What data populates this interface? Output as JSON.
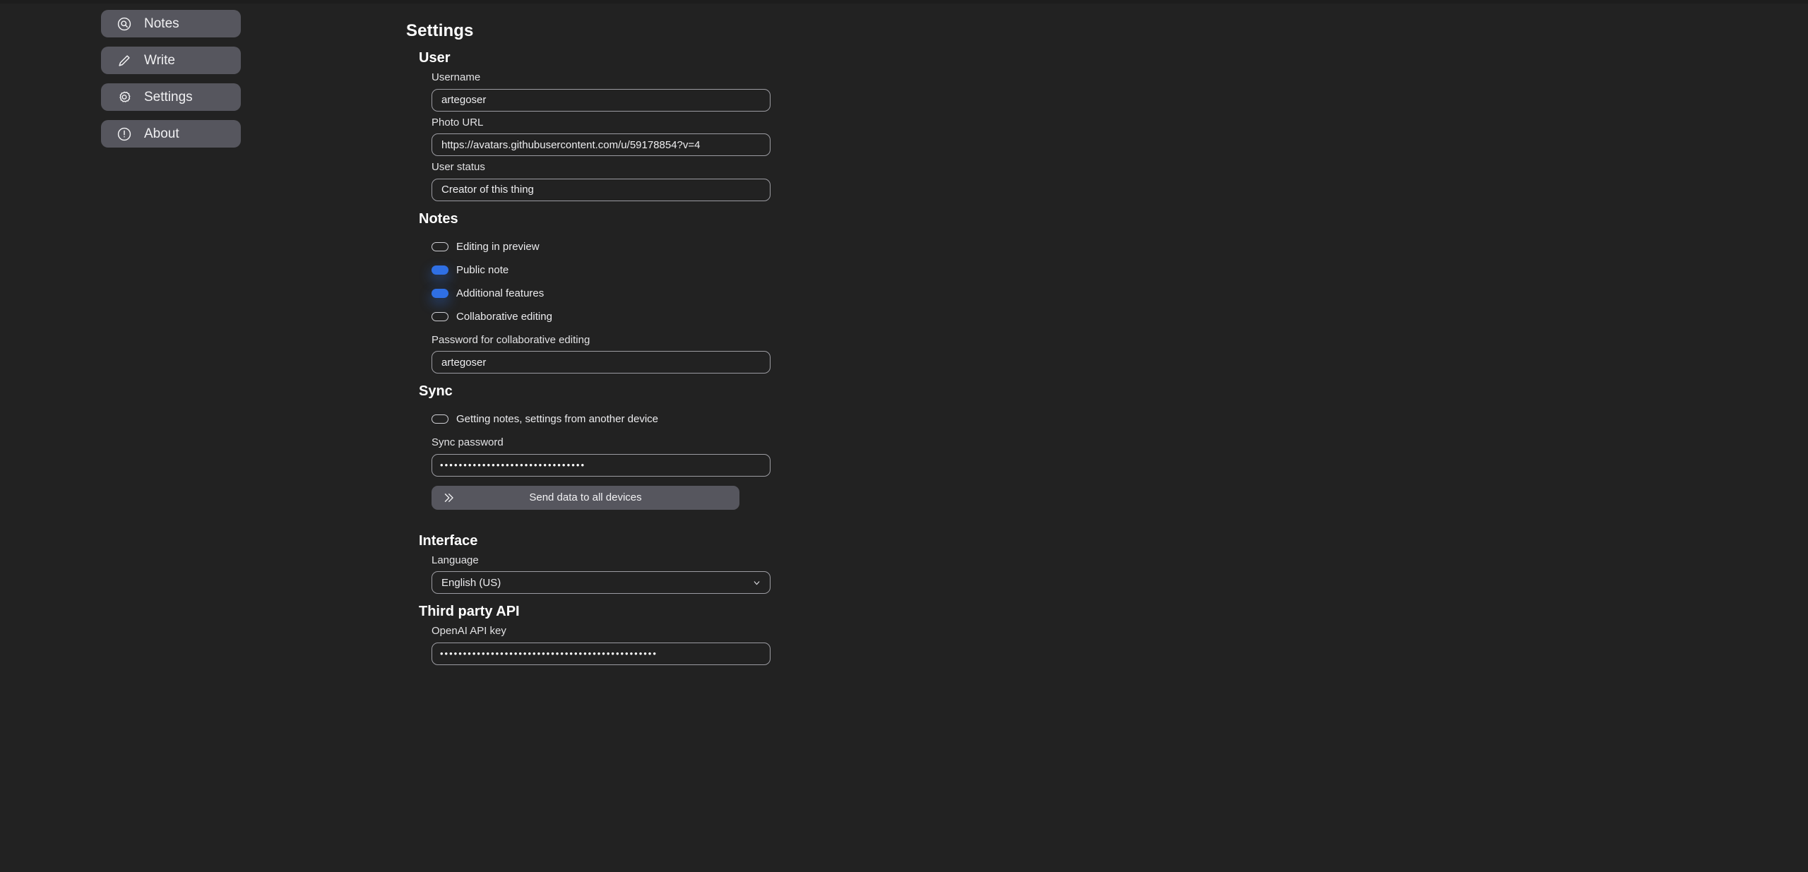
{
  "sidebar": {
    "items": [
      {
        "label": "Notes",
        "icon": "search-circle-icon",
        "name": "notes"
      },
      {
        "label": "Write",
        "icon": "pencil-icon",
        "name": "write"
      },
      {
        "label": "Settings",
        "icon": "gear-icon",
        "name": "settings"
      },
      {
        "label": "About",
        "icon": "info-circle-icon",
        "name": "about"
      }
    ]
  },
  "page": {
    "title": "Settings"
  },
  "sections": {
    "user": {
      "title": "User",
      "username": {
        "label": "Username",
        "value": "artegoser"
      },
      "photo_url": {
        "label": "Photo URL",
        "value": "https://avatars.githubusercontent.com/u/59178854?v=4"
      },
      "user_status": {
        "label": "User status",
        "value": "Creator of this thing"
      }
    },
    "notes": {
      "title": "Notes",
      "toggles": [
        {
          "label": "Editing in preview",
          "on": false
        },
        {
          "label": "Public note",
          "on": true
        },
        {
          "label": "Additional features",
          "on": true
        },
        {
          "label": "Collaborative editing",
          "on": false
        }
      ],
      "collab_password": {
        "label": "Password for collaborative editing",
        "value": "artegoser"
      }
    },
    "sync": {
      "title": "Sync",
      "toggles": [
        {
          "label": "Getting notes, settings from another device",
          "on": false
        }
      ],
      "sync_password": {
        "label": "Sync password",
        "value": "•••••••••••••••••••••••••••••••"
      },
      "send_button": {
        "label": "Send data to all devices",
        "icon": "chevron-double-right-icon"
      }
    },
    "interface": {
      "title": "Interface",
      "language": {
        "label": "Language",
        "value": "English (US)",
        "options": [
          "English (US)"
        ]
      }
    },
    "third_party_api": {
      "title": "Third party API",
      "openai_key": {
        "label": "OpenAI API key",
        "value": "•••••••••••••••••••••••••••••••••••••••••••••••"
      }
    }
  },
  "colors": {
    "background": "#222222",
    "nav_button": "#56565e",
    "toggle_on": "#2f6fe4",
    "border": "#9c9ca2",
    "text": "#eeeef0"
  }
}
